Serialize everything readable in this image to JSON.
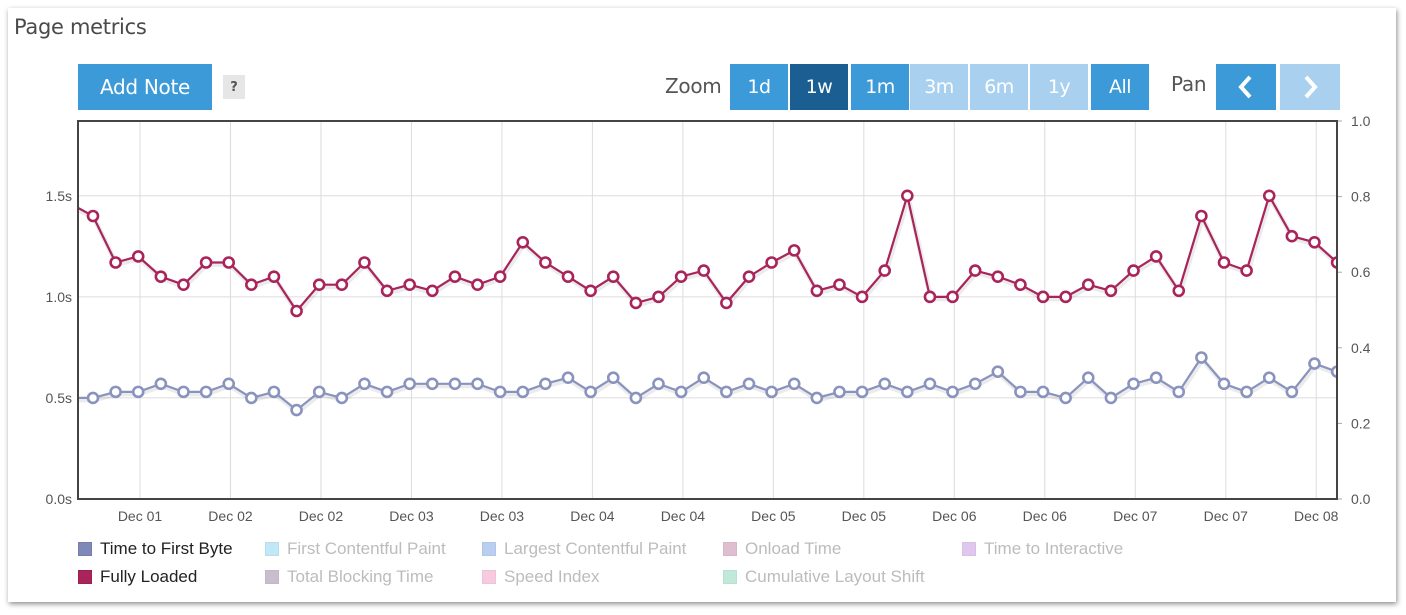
{
  "panel": {
    "title": "Page metrics",
    "add_note_label": "Add Note",
    "help_label": "?"
  },
  "zoom": {
    "label": "Zoom",
    "options": [
      {
        "label": "1d",
        "state": "enabled"
      },
      {
        "label": "1w",
        "state": "selected"
      },
      {
        "label": "1m",
        "state": "enabled"
      },
      {
        "label": "3m",
        "state": "disabled"
      },
      {
        "label": "6m",
        "state": "disabled"
      },
      {
        "label": "1y",
        "state": "disabled"
      },
      {
        "label": "All",
        "state": "enabled"
      }
    ]
  },
  "pan": {
    "label": "Pan",
    "prev_icon": "chevron-left-icon",
    "next_icon": "chevron-right-icon",
    "prev_enabled": true,
    "next_enabled": false
  },
  "chart_data": {
    "type": "line",
    "title": "Page metrics",
    "xlabel": "",
    "ylabel": "",
    "y_left": {
      "ticks": [
        "0.0s",
        "0.5s",
        "1.0s",
        "1.5s"
      ],
      "tick_values": [
        0,
        0.5,
        1.0,
        1.5
      ],
      "range": [
        0,
        1.87
      ],
      "unit": "s"
    },
    "y_right": {
      "ticks": [
        "0.0",
        "0.2",
        "0.4",
        "0.6",
        "0.8",
        "1.0"
      ],
      "tick_values": [
        0,
        0.2,
        0.4,
        0.6,
        0.8,
        1.0
      ],
      "range": [
        0,
        1.0
      ]
    },
    "x_tick_labels": [
      "Dec 01",
      "Dec 02",
      "Dec 02",
      "Dec 03",
      "Dec 03",
      "Dec 04",
      "Dec 04",
      "Dec 05",
      "Dec 05",
      "Dec 06",
      "Dec 06",
      "Dec 07",
      "Dec 07",
      "Dec 08"
    ],
    "x_range_points": [
      -0.67,
      55
    ],
    "grid": true,
    "legend_position": "bottom",
    "series": [
      {
        "name": "Time to First Byte",
        "color": "#8a93bd",
        "visible": true,
        "values": [
          0.5,
          0.53,
          0.53,
          0.57,
          0.53,
          0.53,
          0.57,
          0.5,
          0.53,
          0.44,
          0.53,
          0.5,
          0.57,
          0.53,
          0.57,
          0.57,
          0.57,
          0.57,
          0.53,
          0.53,
          0.57,
          0.6,
          0.53,
          0.6,
          0.5,
          0.57,
          0.53,
          0.6,
          0.53,
          0.57,
          0.53,
          0.57,
          0.5,
          0.53,
          0.53,
          0.57,
          0.53,
          0.57,
          0.53,
          0.57,
          0.63,
          0.53,
          0.53,
          0.5,
          0.6,
          0.5,
          0.57,
          0.6,
          0.53,
          0.7,
          0.57,
          0.53,
          0.6,
          0.53,
          0.67,
          0.63
        ]
      },
      {
        "name": "Fully Loaded",
        "color": "#a8245a",
        "visible": true,
        "values": [
          1.4,
          1.17,
          1.2,
          1.1,
          1.06,
          1.17,
          1.17,
          1.06,
          1.1,
          0.93,
          1.06,
          1.06,
          1.17,
          1.03,
          1.06,
          1.03,
          1.1,
          1.06,
          1.1,
          1.27,
          1.17,
          1.1,
          1.03,
          1.1,
          0.97,
          1.0,
          1.1,
          1.13,
          0.97,
          1.1,
          1.17,
          1.23,
          1.03,
          1.06,
          1.0,
          1.13,
          1.5,
          1.0,
          1.0,
          1.13,
          1.1,
          1.06,
          1.0,
          1.0,
          1.06,
          1.03,
          1.13,
          1.2,
          1.03,
          1.4,
          1.17,
          1.13,
          1.5,
          1.3,
          1.27,
          1.17
        ],
        "left_edge_value": 1.44
      }
    ]
  },
  "legend": [
    {
      "label": "Time to First Byte",
      "color": "#7f89b8",
      "active": true
    },
    {
      "label": "First Contentful Paint",
      "color": "#8fd4f5",
      "active": false
    },
    {
      "label": "Largest Contentful Paint",
      "color": "#7fa8e8",
      "active": false
    },
    {
      "label": "Onload Time",
      "color": "#c48aa8",
      "active": false
    },
    {
      "label": "Time to Interactive",
      "color": "#c69ae0",
      "active": false
    },
    {
      "label": "Fully Loaded",
      "color": "#a8245a",
      "active": true
    },
    {
      "label": "Total Blocking Time",
      "color": "#a088a8",
      "active": false
    },
    {
      "label": "Speed Index",
      "color": "#f2a0c8",
      "active": false
    },
    {
      "label": "Cumulative Layout Shift",
      "color": "#8fd8bc",
      "active": false
    }
  ]
}
